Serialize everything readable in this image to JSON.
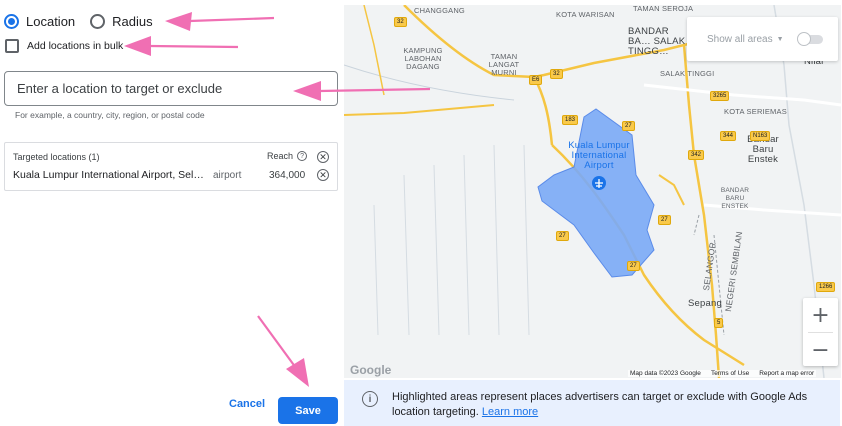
{
  "options": {
    "location_label": "Location",
    "radius_label": "Radius",
    "bulk_label": "Add locations in bulk"
  },
  "search": {
    "placeholder": "Enter a location to target or exclude",
    "hint": "For example, a country, city, region, or postal code"
  },
  "targeted": {
    "header": "Targeted locations (1)",
    "reach_header": "Reach",
    "rows": [
      {
        "name": "Kuala Lumpur International Airport, Sel…",
        "type": "airport",
        "reach": "364,000"
      }
    ]
  },
  "buttons": {
    "cancel": "Cancel",
    "save": "Save"
  },
  "map": {
    "show_areas_label": "Show all areas",
    "show_areas_enabled": false,
    "logo": "Google",
    "attribution": [
      "Map data ©2023 Google",
      "Terms of Use",
      "Report a map error"
    ],
    "zoom_in": "+",
    "zoom_out": "−",
    "place_labels": {
      "changgang": "CHANGGANG",
      "kota_warisan": "KOTA WARISAN",
      "taman_seroja": "TAMAN SEROJA",
      "bandar_baru_salak_tinggi": "BANDAR BA… SALAK TINGG…",
      "kampung_labohan_dagang": "KAMPUNG LABOHAN DAGANG",
      "taman_langat_murni": "TAMAN LANGAT MURNI",
      "salak_tinggi": "SALAK TINGGI",
      "nilai": "Nilai",
      "kota_seriemas": "KOTA SERIEMAS",
      "klia": "Kuala Lumpur International Airport",
      "bandar_baru_enstek": "Bandar Baru Enstek",
      "bandar_baru_enstek_small": "BANDAR BARU ENSTEK",
      "selangor": "SELANGOR",
      "negeri_sembilan": "NEGERI SEMBILAN",
      "sepang": "Sepang"
    },
    "road_shields": [
      "32",
      "E6",
      "32",
      "183",
      "27",
      "342",
      "3265",
      "344",
      "N163",
      "27",
      "27",
      "27",
      "1266",
      "5"
    ],
    "area_color": "#7baaf7"
  },
  "notice": {
    "text": "Highlighted areas represent places advertisers can target or exclude with Google Ads location targeting.",
    "link": "Learn more"
  }
}
